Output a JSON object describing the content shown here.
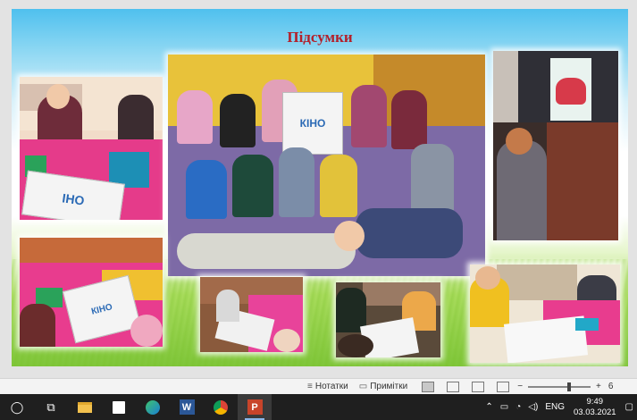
{
  "slide": {
    "title": "Підсумки",
    "title_color": "#b3202a",
    "poster_text": "КІНО",
    "poster_text_short": "ІНО",
    "photos": [
      {
        "name": "photo-children-drawing-1"
      },
      {
        "name": "photo-group-kino"
      },
      {
        "name": "photo-projector-screen"
      },
      {
        "name": "photo-children-drawing-2"
      },
      {
        "name": "photo-children-drawing-3"
      },
      {
        "name": "photo-children-drawing-4"
      },
      {
        "name": "photo-children-drawing-5"
      }
    ]
  },
  "status_bar": {
    "notes_label": "Нотатки",
    "comments_label": "Примітки",
    "zoom_minus": "−",
    "zoom_plus": "+",
    "zoom_value": 6
  },
  "taskbar": {
    "apps": [
      {
        "name": "search-icon",
        "glyph": "◯"
      },
      {
        "name": "task-view-icon",
        "glyph": "⧉"
      },
      {
        "name": "file-explorer-icon",
        "glyph": "▆"
      },
      {
        "name": "store-icon",
        "glyph": "▣"
      },
      {
        "name": "edge-icon",
        "glyph": "e"
      },
      {
        "name": "word-icon",
        "glyph": "W"
      },
      {
        "name": "chrome-icon",
        "glyph": "◉"
      },
      {
        "name": "powerpoint-icon",
        "glyph": "P"
      }
    ],
    "tray": {
      "language": "ENG",
      "time": "9:49",
      "date": "03.03.2021"
    }
  }
}
